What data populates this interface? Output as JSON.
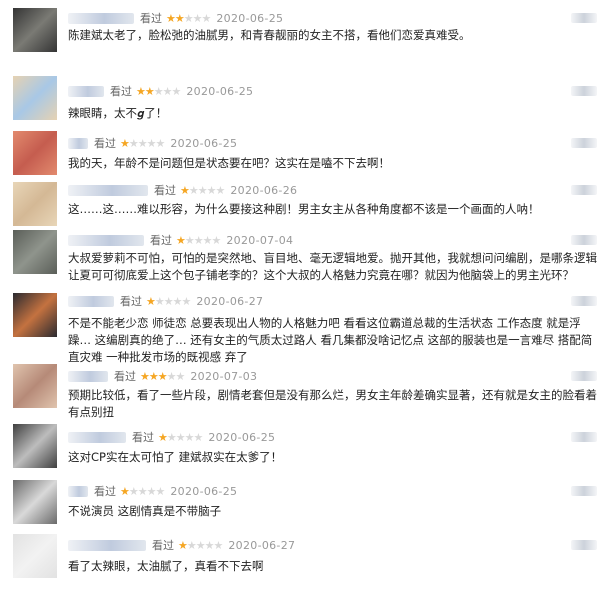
{
  "reviews": [
    {
      "label": "看过",
      "stars": 2,
      "date": "2020-06-25",
      "text": "陈建斌太老了，脸松弛的油腻男，和青春靓丽的女主不搭，看他们恋爱真难受。",
      "avatar_colors": [
        "#343434",
        "#7a7a74"
      ]
    },
    {
      "label": "看过",
      "stars": 2,
      "date": "2020-06-25",
      "text": "辣眼睛，太不𝒈了！",
      "avatar_colors": [
        "#e6d2b2",
        "#a8c8e6"
      ]
    },
    {
      "label": "看过",
      "stars": 1,
      "date": "2020-06-25",
      "text": "我的天，年龄不是问题但是状态要在吧？这实在是嗑不下去啊！",
      "avatar_colors": [
        "#e28a6e",
        "#c55d4f"
      ]
    },
    {
      "label": "看过",
      "stars": 1,
      "date": "2020-06-26",
      "text": "这……这……难以形容，为什么要接这种剧！男主女主从各种角度都不该是一个画面的人呐！",
      "avatar_colors": [
        "#e8d6b8",
        "#d4b895"
      ]
    },
    {
      "label": "看过",
      "stars": 1,
      "date": "2020-07-04",
      "text": "大叔爱萝莉不可怕，可怕的是突然地、盲目地、毫无逻辑地爱。抛开其他，我就想问问编剧，是哪条逻辑让夏可可彻底爱上这个包子铺老李的？这个大叔的人格魅力究竟在哪？就因为他脑袋上的男主光环？",
      "avatar_colors": [
        "#5a5e58",
        "#8f948c"
      ]
    },
    {
      "label": "看过",
      "stars": 1,
      "date": "2020-06-27",
      "text": "不是不能老少恋 师徒恋 总要表现出人物的人格魅力吧 看看这位霸道总裁的生活状态 工作态度 就是浮躁… 这编剧真的绝了… 还有女主的气质太过路人 看几集都没啥记忆点 这部的服装也是一言难尽 搭配简直灾难 一种批发市场的既视感 弃了",
      "avatar_colors": [
        "#2a2a30",
        "#c47240"
      ]
    },
    {
      "label": "看过",
      "stars": 3,
      "date": "2020-07-03",
      "text": "预期比较低，看了一些片段，剧情老套但是没有那么烂，男女主年龄差确实显著，还有就是女主的脸看着有点别扭",
      "avatar_colors": [
        "#e0c4ae",
        "#b68a78"
      ]
    },
    {
      "label": "看过",
      "stars": 1,
      "date": "2020-06-25",
      "text": "这对CP实在太可怕了 建斌叔实在太爹了！",
      "avatar_colors": [
        "#3f3f3f",
        "#bdbdbd"
      ]
    },
    {
      "label": "看过",
      "stars": 1,
      "date": "2020-06-25",
      "text": "不说演员 这剧情真是不带脑子",
      "avatar_colors": [
        "#6a6a6a",
        "#d9d9d9"
      ]
    },
    {
      "label": "看过",
      "stars": 1,
      "date": "2020-06-27",
      "text": "看了太辣眼，太油腻了，真看不下去啊",
      "avatar_colors": [
        "#e2e2e2",
        "#f2f2f2"
      ]
    }
  ]
}
